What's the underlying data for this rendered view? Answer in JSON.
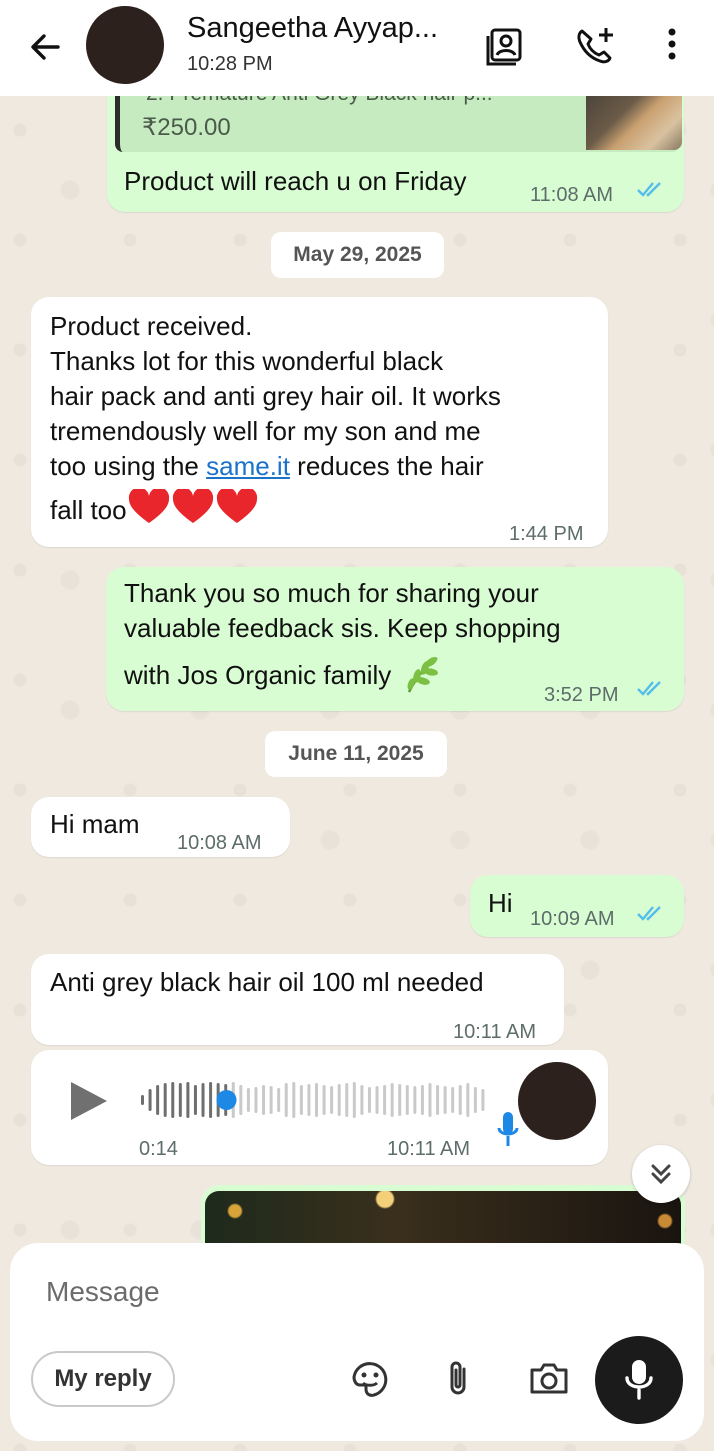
{
  "header": {
    "contact_name": "Sangeetha Ayyap...",
    "status": "10:28 PM"
  },
  "messages": {
    "product_card": {
      "title_fragment": "2. Premature Anti Grey Black hair p...",
      "price": "₹250.00",
      "text": "Product will reach u on Friday",
      "time": "11:08 AM"
    },
    "date1": "May 29, 2025",
    "received": {
      "line1": "Product  received.",
      "line2": "Thanks lot for this wonderful black",
      "line3": "hair pack and anti grey hair oil. It works",
      "line4": "tremendously well for my son and me",
      "line5_pre": "too using the ",
      "line5_link": "same.it",
      "line5_post": " reduces the hair",
      "line6": "fall too",
      "time": "1:44 PM"
    },
    "thanks": {
      "line1": "Thank you so much for sharing your",
      "line2": "valuable feedback sis. Keep shopping",
      "line3": "with Jos Organic family",
      "time": "3:52 PM"
    },
    "date2": "June 11, 2025",
    "hi_mam": {
      "text": "Hi mam",
      "time": "10:08 AM"
    },
    "hi": {
      "text": "Hi",
      "time": "10:09 AM"
    },
    "oil_request": {
      "text": "Anti  grey black hair oil 100 ml needed",
      "time": "10:11 AM"
    },
    "voice": {
      "duration": "0:14",
      "time": "10:11 AM",
      "progress": 0.24
    }
  },
  "composer": {
    "placeholder": "Message",
    "my_reply_label": "My reply"
  },
  "colors": {
    "outgoing": "#d9fdd3",
    "incoming": "#ffffff",
    "read_ticks": "#53bdeb",
    "link": "#1a73c9",
    "voice_progress": "#1e88e5"
  }
}
